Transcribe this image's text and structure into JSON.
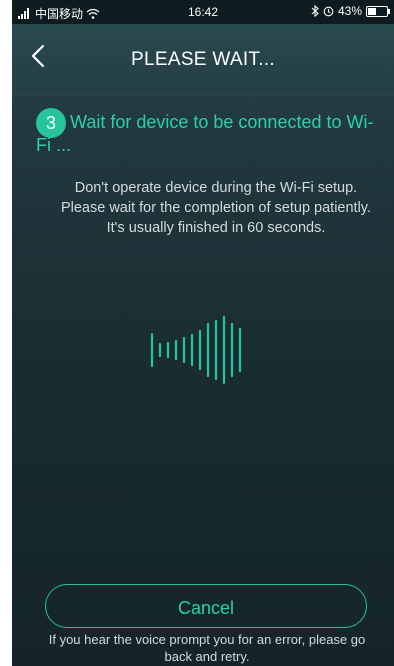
{
  "status_bar": {
    "carrier": "中国移动",
    "time": "16:42",
    "battery_percent": "43%",
    "battery_level": 0.43
  },
  "header": {
    "title": "PLEASE WAIT..."
  },
  "step": {
    "number": "3",
    "text": "Wait for device to be connected to Wi-Fi ..."
  },
  "instructions": "Don't operate device during the Wi-Fi setup. Please wait for the completion of setup patiently. It's usually finished in 60 seconds.",
  "actions": {
    "cancel_label": "Cancel"
  },
  "footer_note": "If you hear the voice prompt you for an error, please go back and retry.",
  "colors": {
    "accent": "#2ad3a6",
    "badge": "#27c39b"
  },
  "icons": {
    "back": "chevron-left-icon",
    "wave": "sound-wave-icon"
  }
}
